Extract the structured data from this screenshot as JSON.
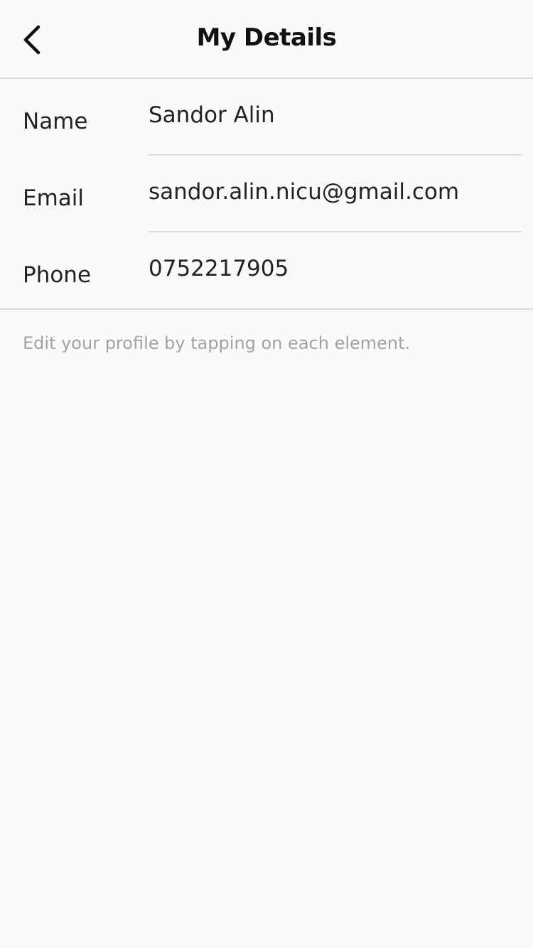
{
  "header": {
    "title": "My Details",
    "back_icon": "chevron-left-icon"
  },
  "details": {
    "rows": [
      {
        "label": "Name",
        "value": "Sandor Alin"
      },
      {
        "label": "Email",
        "value": "sandor.alin.nicu@gmail.com"
      },
      {
        "label": "Phone",
        "value": "0752217905"
      }
    ]
  },
  "hint": "Edit your profile by tapping on each element.",
  "colors": {
    "background": "#fafafa",
    "divider": "#dadada",
    "text": "#222222",
    "hint_text": "#a2a2a2"
  }
}
